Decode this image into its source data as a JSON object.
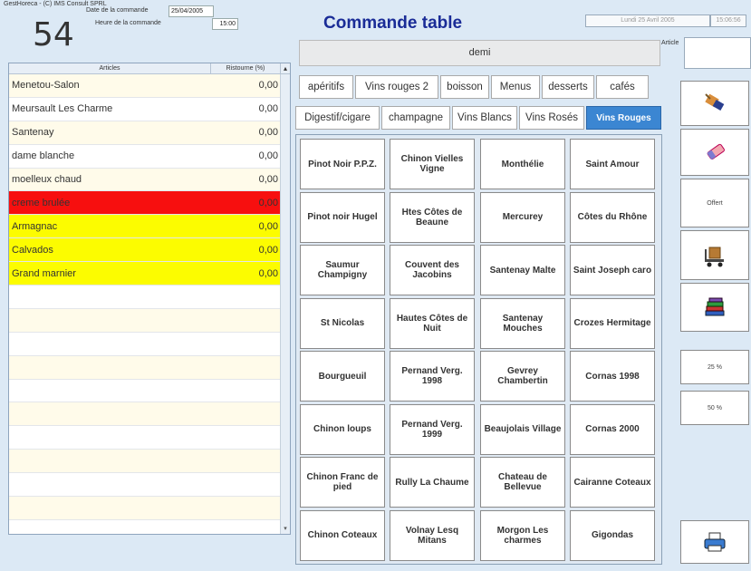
{
  "app_title": "GestHoreca - (C) IMS Consult SPRL",
  "table_number": "54",
  "order": {
    "date_label": "Date de la commande",
    "date_value": "25/04/2005",
    "time_label": "Heure de la commande",
    "time_value": "15:00"
  },
  "list": {
    "col_article": "Articles",
    "col_discount": "Ristourne (%)",
    "rows": [
      {
        "name": "Menetou-Salon",
        "value": "0,00",
        "bg": "#fffbea"
      },
      {
        "name": "Meursault Les Charme",
        "value": "0,00",
        "bg": "#ffffff"
      },
      {
        "name": "Santenay",
        "value": "0,00",
        "bg": "#fffbea"
      },
      {
        "name": "dame blanche",
        "value": "0,00",
        "bg": "#ffffff"
      },
      {
        "name": "moelleux chaud",
        "value": "0,00",
        "bg": "#fffbea"
      },
      {
        "name": "creme brulée",
        "value": "0,00",
        "bg": "#f70f0f"
      },
      {
        "name": "Armagnac",
        "value": "0,00",
        "bg": "#fcfc00"
      },
      {
        "name": "Calvados",
        "value": "0,00",
        "bg": "#fcfc00"
      },
      {
        "name": "Grand marnier",
        "value": "0,00",
        "bg": "#fcfc00"
      }
    ],
    "empty_row_count": 11
  },
  "header": {
    "title": "Commande table",
    "date_display": "Lundi 25 Avril 2005",
    "time_display": "15:06:56",
    "article_label": "Article"
  },
  "selected_variant": "demi",
  "tabs_row1": [
    "apéritifs",
    "Vins rouges 2",
    "boisson",
    "Menus",
    "desserts",
    "cafés"
  ],
  "tabs_row2": [
    "Digestif/cigare",
    "champagne",
    "Vins Blancs",
    "Vins Rosés",
    "Vins Rouges"
  ],
  "active_tab": "Vins Rouges",
  "wines": [
    [
      "Pinot Noir P.P.Z.",
      "Chinon Vielles Vigne",
      "Monthélie",
      "Saint Amour"
    ],
    [
      "Pinot noir Hugel",
      "Htes Côtes de Beaune",
      "Mercurey",
      "Côtes du Rhône"
    ],
    [
      "Saumur Champigny",
      "Couvent des Jacobins",
      "Santenay Malte",
      "Saint Joseph caro"
    ],
    [
      "St Nicolas",
      "Hautes Côtes de Nuit",
      "Santenay Mouches",
      "Crozes Hermitage"
    ],
    [
      "Bourgueuil",
      "Pernand Verg. 1998",
      "Gevrey Chambertin",
      "Cornas 1998"
    ],
    [
      "Chinon loups",
      "Pernand Verg. 1999",
      "Beaujolais Village",
      "Cornas 2000"
    ],
    [
      "Chinon Franc de pied",
      "Rully La Chaume",
      "Chateau de Bellevue",
      "Cairanne Coteaux"
    ],
    [
      "Chinon Coteaux",
      "Volnay Lesq Mitans",
      "Morgon Les charmes",
      "Gigondas"
    ]
  ],
  "side": {
    "offert_label": "Offert",
    "pct25_label": "25 %",
    "pct50_label": "50 %",
    "icons": [
      "broom-icon",
      "eraser-icon",
      "trolley-icon",
      "books-icon",
      "printer-icon"
    ]
  },
  "colors": {
    "title": "#1a2c97",
    "active_tab": "#3b86d2",
    "row_red": "#f70f0f",
    "row_yellow": "#fcfc00",
    "background": "#dce9f5"
  }
}
